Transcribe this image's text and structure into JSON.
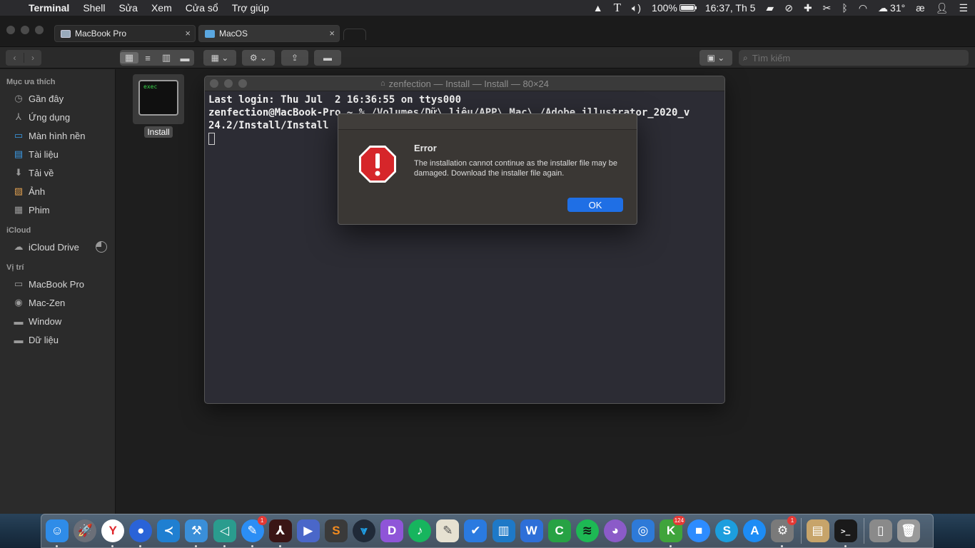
{
  "menubar": {
    "apple": "",
    "app_name": "Terminal",
    "items": [
      "Shell",
      "Sửa",
      "Xem",
      "Cửa sổ",
      "Trợ giúp"
    ],
    "battery": "100%",
    "battery_level": 1.0,
    "clock": "16:37, Th 5",
    "temperature": "31°",
    "input_method": "æ"
  },
  "finder": {
    "tabs": [
      {
        "label": "MacBook Pro",
        "icon": "laptop-icon"
      },
      {
        "label": "MacOS",
        "icon": "folder-icon"
      }
    ],
    "search": {
      "placeholder": "Tìm kiếm"
    },
    "sidebar": {
      "favorites_header": "Mục ưa thích",
      "favorites": [
        {
          "label": "Gần đây",
          "icon": "clock-icon"
        },
        {
          "label": "Ứng dụng",
          "icon": "applications-icon"
        },
        {
          "label": "Màn hình nền",
          "icon": "desktop-icon"
        },
        {
          "label": "Tài liệu",
          "icon": "documents-icon"
        },
        {
          "label": "Tải về",
          "icon": "downloads-icon"
        },
        {
          "label": "Ảnh",
          "icon": "pictures-icon"
        },
        {
          "label": "Phim",
          "icon": "movies-icon"
        }
      ],
      "icloud_header": "iCloud",
      "icloud": [
        {
          "label": "iCloud Drive",
          "icon": "cloud-icon",
          "sync_progress": 0.75
        }
      ],
      "locations_header": "Vị trí",
      "locations": [
        {
          "label": "MacBook Pro",
          "icon": "laptop-icon"
        },
        {
          "label": "Mac-Zen",
          "icon": "disk-icon"
        },
        {
          "label": "Window",
          "icon": "folder-icon"
        },
        {
          "label": "Dữ liệu",
          "icon": "folder-icon"
        }
      ]
    },
    "file": {
      "name": "Install",
      "icon_text": "exec"
    }
  },
  "terminal": {
    "title": "zenfection — Install — Install — 80×24",
    "lines": [
      "Last login: Thu Jul  2 16:36:55 on ttys000",
      "zenfection@MacBook-Pro ~ % /Volumes/Dữ\\ liệu/APP\\ Mac\\ /Adobe_illustrator_2020_v",
      "24.2/Install/Install"
    ]
  },
  "dialog": {
    "title": "Error",
    "message": "The installation cannot continue as the installer file may be damaged. Download the installer file again.",
    "ok_label": "OK",
    "icon": "stop-icon"
  },
  "dock": {
    "apps": [
      {
        "name": "finder",
        "color": "#2f8ce8",
        "glyph": "☺",
        "running": true
      },
      {
        "name": "launchpad",
        "color": "#6b6f78",
        "glyph": "🚀",
        "round": true,
        "running": false
      },
      {
        "name": "yandex-browser",
        "color": "#ffffff",
        "glyph": "Y",
        "fg": "#e0262b",
        "round": true,
        "running": true
      },
      {
        "name": "firefox",
        "color": "#2a63d8",
        "glyph": "●",
        "round": true,
        "running": true
      },
      {
        "name": "vscode",
        "color": "#1f7fd1",
        "glyph": "≺",
        "running": false
      },
      {
        "name": "xcode",
        "color": "#3a8fd9",
        "glyph": "⚒",
        "running": true
      },
      {
        "name": "visual-studio",
        "color": "#2a9c8e",
        "glyph": "◁",
        "running": true
      },
      {
        "name": "messenger",
        "color": "#2b8ef5",
        "glyph": "✎",
        "round": true,
        "badge": "1",
        "running": true
      },
      {
        "name": "acrobat",
        "color": "#3a1515",
        "glyph": "⅄",
        "running": true
      },
      {
        "name": "keynote",
        "color": "#4a67c9",
        "glyph": "▶",
        "running": false
      },
      {
        "name": "sublime-text",
        "color": "#3a3a3a",
        "glyph": "S",
        "fg": "#f28b1f",
        "running": false
      },
      {
        "name": "sourcetree",
        "color": "#202a38",
        "glyph": "⩔",
        "fg": "#1fa0e8",
        "round": true,
        "running": false
      },
      {
        "name": "dashcoin",
        "color": "#8f55d8",
        "glyph": "D",
        "running": false
      },
      {
        "name": "evernote",
        "color": "#17b55e",
        "glyph": "♪",
        "round": true,
        "running": false
      },
      {
        "name": "textedit",
        "color": "#e6e1d1",
        "glyph": "✎",
        "fg": "#555555",
        "running": false
      },
      {
        "name": "todo",
        "color": "#2a7ae0",
        "glyph": "✔",
        "running": false
      },
      {
        "name": "trello",
        "color": "#1e79c7",
        "glyph": "▥",
        "running": false
      },
      {
        "name": "word",
        "color": "#2e6fd8",
        "glyph": "W",
        "running": false
      },
      {
        "name": "camtasia",
        "color": "#27a244",
        "glyph": "C",
        "running": false
      },
      {
        "name": "spotify",
        "color": "#1db954",
        "glyph": "≋",
        "fg": "#111111",
        "round": true,
        "running": false
      },
      {
        "name": "github-desktop",
        "color": "#8b5bc8",
        "glyph": "◕",
        "round": true,
        "running": false
      },
      {
        "name": "sketch-ring",
        "color": "#2e7ad8",
        "glyph": "◎",
        "running": false
      },
      {
        "name": "kaspersky",
        "color": "#3fa43b",
        "glyph": "K",
        "badge": "124",
        "running": true
      },
      {
        "name": "zoom",
        "color": "#2d8cff",
        "glyph": "■",
        "round": true,
        "running": false
      },
      {
        "name": "skype",
        "color": "#1c9ede",
        "glyph": "S",
        "round": true,
        "running": false
      },
      {
        "name": "app-store",
        "color": "#1d8cf5",
        "glyph": "A",
        "round": true,
        "running": false
      },
      {
        "name": "system-preferences",
        "color": "#7a7a7a",
        "glyph": "⚙",
        "badge": "1",
        "running": true
      }
    ],
    "extras": [
      {
        "name": "archive-utility",
        "color": "#c7a46a",
        "glyph": "▤",
        "running": false
      },
      {
        "name": "terminal",
        "color": "#1a1a1a",
        "glyph": ">_",
        "running": true
      }
    ],
    "trailing": [
      {
        "name": "documents-stack",
        "color": "#8a8a8a",
        "glyph": "▯",
        "running": false
      },
      {
        "name": "trash",
        "color": "#9a9a9a",
        "glyph": "🗑",
        "running": false
      }
    ]
  }
}
